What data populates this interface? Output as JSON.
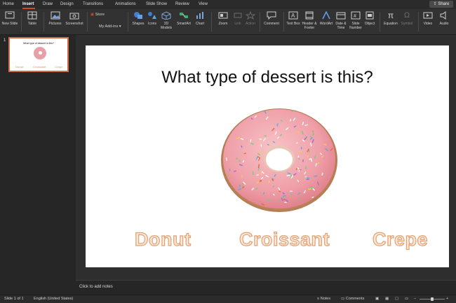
{
  "tabs": [
    "Home",
    "Insert",
    "Draw",
    "Design",
    "Transitions",
    "Animations",
    "Slide Show",
    "Review",
    "View"
  ],
  "active_tab": "Insert",
  "share_label": "Share",
  "ribbon": {
    "new_slide": "New Slide",
    "table": "Table",
    "pictures": "Pictures",
    "screenshot": "Screenshot",
    "store": "Store",
    "my_addins": "My Add-ins",
    "shapes": "Shapes",
    "icons": "Icons",
    "models": "3D Models",
    "smartart": "SmartArt",
    "chart": "Chart",
    "zoom": "Zoom",
    "link": "Link",
    "action": "Action",
    "comment": "Comment",
    "text_box": "Text Box",
    "header_footer": "Header & Footer",
    "wordart": "WordArt",
    "date_time": "Date & Time",
    "slide_number": "Slide Number",
    "object": "Object",
    "equation": "Equation",
    "symbol": "Symbol",
    "video": "Video",
    "audio": "Audio"
  },
  "thumbnail": {
    "number": "1",
    "title": "What type of dessert is this?",
    "options": [
      "Donut",
      "Croissant",
      "Crepe"
    ]
  },
  "slide": {
    "title": "What type of dessert is this?",
    "options": [
      "Donut",
      "Croissant",
      "Crepe"
    ]
  },
  "notes_placeholder": "Click to add notes",
  "status": {
    "slide_info": "Slide 1 of 1",
    "language": "English (United States)",
    "notes": "Notes",
    "comments": "Comments"
  },
  "colors": {
    "accent": "#d24726",
    "option_fill": "#fde6d6",
    "option_stroke": "#e0a274"
  }
}
